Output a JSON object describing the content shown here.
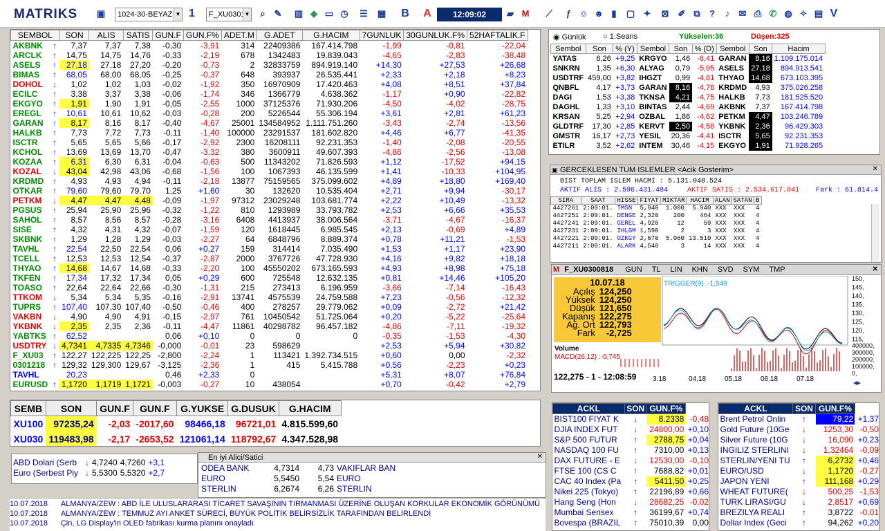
{
  "app": {
    "logo": "MATRIKS",
    "layout": "1024-30-BEYAZ",
    "page_num": "1",
    "symbol": "F_XU0301",
    "clock": "12:09:02",
    "b_label": "B",
    "a_label": "A"
  },
  "market_watch": {
    "headers": [
      "SEMBOL",
      "SON",
      "ALIS",
      "SATIS",
      "GUN.F",
      "GUN.F%",
      "ADET.M",
      "G.ADET",
      "G.HACIM",
      "7GUNLUK",
      "30GUNLUK.F%",
      "52HAFTALIK.F"
    ],
    "rows": [
      [
        "AKBNK",
        "u",
        "7,37",
        "7,37",
        "7,38",
        "-0,30",
        "-3,91",
        "314",
        "22409386",
        "167.414.798",
        "-1,99",
        "-0,81",
        "-22,04",
        ""
      ],
      [
        "ARCLK",
        "u",
        "14,75",
        "14,75",
        "14,76",
        "-0,33",
        "-2,19",
        "678",
        "1342483",
        "19.839.043",
        "-4,65",
        "-2,83",
        "-38,48",
        ""
      ],
      [
        "ASELS",
        "u",
        "27,18",
        "27,18",
        "27,20",
        "-0,20",
        "-0,73",
        "2",
        "32833759",
        "894.919.140",
        "+14,30",
        "+27,53",
        "+26,68",
        "son"
      ],
      [
        "BIMAS",
        "u",
        "68,05",
        "68,00",
        "68,05",
        "-0,25",
        "-0,37",
        "648",
        "393937",
        "26.535.441",
        "+2,33",
        "+2,18",
        "+8,23",
        ""
      ],
      [
        "DOHOL",
        "d",
        "1,02",
        "1,02",
        "1,03",
        "-0,02",
        "-1,92",
        "350",
        "16970909",
        "17.420.463",
        "+4,08",
        "+8,51",
        "+37,84",
        ""
      ],
      [
        "ECILC",
        "u",
        "3,38",
        "3,37",
        "3,38",
        "-0,06",
        "-1,74",
        "346",
        "1366779",
        "4.638.362",
        "-1,17",
        "+0,90",
        "-22,82",
        ""
      ],
      [
        "EKGYO",
        "u",
        "1,91",
        "1,90",
        "1,91",
        "-0,05",
        "-2,55",
        "1000",
        "37125376",
        "71.930.206",
        "-4,50",
        "-4,02",
        "-28,75",
        "son"
      ],
      [
        "EREGL",
        "u",
        "10,61",
        "10,61",
        "10,62",
        "-0,03",
        "-0,28",
        "200",
        "5226544",
        "55.306.194",
        "+3,61",
        "+2,81",
        "+61,23",
        ""
      ],
      [
        "GARAN",
        "u",
        "8,17",
        "8,16",
        "8,17",
        "-0,40",
        "-4,67",
        "25001",
        "134584952",
        "1.111.751.260",
        "-3,43",
        "-2,74",
        "-13,56",
        "son"
      ],
      [
        "HALKB",
        "u",
        "7,73",
        "7,72",
        "7,73",
        "-0,11",
        "-1,40",
        "100000",
        "23291537",
        "181.602.820",
        "+4,46",
        "+6,77",
        "-41,35",
        ""
      ],
      [
        "ISCTR",
        "u",
        "5,65",
        "5,65",
        "5,66",
        "-0,17",
        "-2,92",
        "2300",
        "16208111",
        "92.231.353",
        "-1,40",
        "-2,08",
        "-20,55",
        ""
      ],
      [
        "KCHOL",
        "u",
        "13,69",
        "13,69",
        "13,70",
        "-0,47",
        "-3,32",
        "380",
        "3600911",
        "49.607.393",
        "-4,86",
        "-2,56",
        "-13,08",
        ""
      ],
      [
        "KOZAA",
        "u",
        "6,31",
        "6,30",
        "6,31",
        "-0,04",
        "-0,63",
        "500",
        "11343202",
        "71.826.593",
        "+1,12",
        "-17,52",
        "+94,15",
        "son"
      ],
      [
        "KOZAL",
        "d",
        "43,04",
        "42,98",
        "43,06",
        "-0,68",
        "-1,56",
        "100",
        "1067393",
        "46.135.599",
        "+1,41",
        "-10,33",
        "+104,95",
        "son"
      ],
      [
        "KRDMD",
        "u",
        "4,93",
        "4,93",
        "4,94",
        "-0,11",
        "-2,18",
        "13877",
        "75159565",
        "375.099.602",
        "+4,89",
        "+18,80",
        "+169,40",
        ""
      ],
      [
        "OTKAR",
        "u",
        "79,60",
        "79,60",
        "79,70",
        "1,25",
        "+1,60",
        "30",
        "132620",
        "10.535.404",
        "+2,71",
        "+9,94",
        "-30,17",
        ""
      ],
      [
        "PETKM",
        "d",
        "4,47",
        "4,47",
        "4,48",
        "-0,09",
        "-1,97",
        "97312",
        "23029248",
        "103.681.774",
        "+2,22",
        "+10,49",
        "-13,32",
        "all"
      ],
      [
        "PGSUS",
        "u",
        "25,94",
        "25,90",
        "25,96",
        "-0,32",
        "-1,22",
        "810",
        "1293989",
        "33.793.782",
        "+2,53",
        "+6,66",
        "+35,53",
        ""
      ],
      [
        "SAHOL",
        "u",
        "8,57",
        "8,56",
        "8,57",
        "-0,28",
        "-3,16",
        "6408",
        "4413937",
        "38.006.564",
        "-3,71",
        "-4,67",
        "-16,37",
        ""
      ],
      [
        "SISE",
        "u",
        "4,32",
        "4,31",
        "4,32",
        "-0,07",
        "-1,59",
        "120",
        "1618445",
        "6.985.545",
        "+2,13",
        "-0,69",
        "+4,89",
        ""
      ],
      [
        "SKBNK",
        "u",
        "1,29",
        "1,28",
        "1,29",
        "-0,03",
        "-2,27",
        "64",
        "6848796",
        "8.889.374",
        "+0,78",
        "+11,21",
        "-1,53",
        ""
      ],
      [
        "TAVHL",
        "u",
        "22,54",
        "22,50",
        "22,54",
        "0,06",
        "+0,27",
        "159",
        "314414",
        "7.035.490",
        "+1,53",
        "+1,17",
        "+23,90",
        ""
      ],
      [
        "TCELL",
        "u",
        "12,53",
        "12,53",
        "12,54",
        "-0,37",
        "-2,87",
        "2000",
        "3767726",
        "47.728.930",
        "+4,16",
        "+9,82",
        "+18,18",
        ""
      ],
      [
        "THYAO",
        "u",
        "14,68",
        "14,67",
        "14,68",
        "-0,33",
        "-2,20",
        "100",
        "45550202",
        "673.165.593",
        "+4,93",
        "+8,98",
        "+75,18",
        "son"
      ],
      [
        "TKFEN",
        "u",
        "17,34",
        "17,32",
        "17,34",
        "0,05",
        "+0,29",
        "600",
        "725548",
        "12.632.135",
        "+0,81",
        "+14,46",
        "+105,20",
        ""
      ],
      [
        "TOASO",
        "u",
        "22,64",
        "22,64",
        "22,66",
        "-0,30",
        "-1,31",
        "215",
        "273413",
        "6.196.959",
        "-3,66",
        "-7,14",
        "-16,43",
        ""
      ],
      [
        "TTKOM",
        "d",
        "5,34",
        "5,34",
        "5,35",
        "-0,16",
        "-2,91",
        "13741",
        "4575539",
        "24.759.588",
        "+7,23",
        "-0,56",
        "-12,32",
        ""
      ],
      [
        "TUPRS",
        "u",
        "107,40",
        "107,30",
        "107,40",
        "-0,50",
        "-0,46",
        "400",
        "278257",
        "29.779.062",
        "+0,09",
        "-2,72",
        "+21,42",
        ""
      ],
      [
        "VAKBN",
        "d",
        "4,90",
        "4,90",
        "4,91",
        "-0,15",
        "-2,97",
        "761",
        "10450542",
        "51.725.064",
        "+0,20",
        "-5,22",
        "-25,64",
        ""
      ],
      [
        "YKBNK",
        "d",
        "2,35",
        "2,35",
        "2,36",
        "-0,11",
        "-4,47",
        "11861",
        "40298782",
        "96.457.182",
        "-4,86",
        "-7,11",
        "-19,32",
        "son"
      ],
      [
        "YABTKS",
        "u",
        "62,52",
        "",
        "",
        "0,06",
        "+0,10",
        "0",
        "0",
        "0",
        "-0,35",
        "-1,53",
        "-4,30",
        ""
      ],
      [
        "USDTRY",
        "d",
        "4,7341",
        "4,7335",
        "4,7346",
        "-0,000",
        "-0,01",
        "23",
        "598629",
        "",
        "+2,53",
        "+5,94",
        "+30,82",
        "all"
      ],
      [
        "F_XU03",
        "u",
        "122,27",
        "122,225",
        "122,25",
        "-2,800",
        "-2,24",
        "1",
        "113421",
        "1.392.734.515",
        "+0,60",
        "0,00",
        "-2,32",
        ""
      ],
      [
        "0301218",
        "u",
        "129,32",
        "129,300",
        "129,67",
        "-3,125",
        "-2,36",
        "1",
        "415",
        "5.415.788",
        "+0,56",
        "-2,23",
        "+0,23",
        ""
      ],
      [
        "TAVHL",
        "",
        "20,23",
        "",
        "",
        "0,46",
        "+2,33",
        "0",
        "",
        "",
        "+5,31",
        "+8,07",
        "+76,84",
        ""
      ],
      [
        "EURUSD",
        "u",
        "1,1720",
        "1,1719",
        "1,1721",
        "-0,003",
        "-0,27",
        "10",
        "438054",
        "",
        "+0,70",
        "-0,42",
        "+2,79",
        "all"
      ]
    ]
  },
  "indices": {
    "headers": [
      "SEMB",
      "SON",
      "GUN.F",
      "GUN.F",
      "G.YUKSE",
      "G.DUSUK",
      "G.HACIM"
    ],
    "rows": [
      [
        "XU100",
        "97235,24",
        "-2,03",
        "-2017,60",
        "98466,18",
        "96721,01",
        "4.815.599,60"
      ],
      [
        "XU030",
        "119483,98",
        "-2,17",
        "-2653,52",
        "121061,14",
        "118792,67",
        "4.347.528,98"
      ]
    ]
  },
  "fx": {
    "rows": [
      [
        "ABD Dolari (Serb",
        "4,7240",
        "4,7260",
        "+3,1"
      ],
      [
        "Euro (Serbest Piy",
        "5,5300",
        "5,5320",
        "+2,7"
      ]
    ]
  },
  "best_bid": {
    "title": "En iyi Alici/Satici",
    "rows": [
      [
        "ODEA BANK",
        "4,7314",
        "4,73",
        "VAKIFLAR BAN"
      ],
      [
        "EURO",
        "5,5450",
        "5,54",
        "EURO"
      ],
      [
        "STERLIN",
        "6,2674",
        "6,26",
        "STERLIN"
      ]
    ]
  },
  "news": [
    [
      "10.07.2018",
      "ALMANYA/ZEW : ABD İLE ULUSLARARASI TİCARET SAVAŞININ TIRMANMASI ÜZERİNE OLUŞAN KORKULAR EKONOMİK GÖRÜNÜMÜ"
    ],
    [
      "10.07.2018",
      "ALMANYA/ZEW : TEMMUZ AYI ANKET SÜRECİ, BÜYÜK POLİTİK BELİRSİZLİK TARAFINDAN BELİRLENDİ"
    ],
    [
      "10.07.2018",
      "Çin, LG Display'in OLED fabrikası kurma planını onayladı"
    ]
  ],
  "ranking": {
    "radio1": "Günlük",
    "radio2": "1.Seans",
    "up_label": "Yükselen:36",
    "down_label": "Düşen:325",
    "headers": [
      "Sembol",
      "Son",
      "% (Y)",
      "Sembol",
      "Son",
      "% (D)",
      "Sembol",
      "Son",
      "Hacim"
    ],
    "rows": [
      [
        "YATAS",
        "6,26",
        "+9,25",
        "KRGYO",
        "1,46",
        "-6,41",
        "GARAN",
        "8,16",
        "1.109.175.014"
      ],
      [
        "SNKRN",
        "1,35",
        "+6,30",
        "ALYAG",
        "0,79",
        "-5,95",
        "ASELS",
        "27,18",
        "894.913.541"
      ],
      [
        "USDTRF",
        "459,00",
        "+3,82",
        "IHGZT",
        "0,99",
        "-4,81",
        "THYAO",
        "14,68",
        "673.103.395"
      ],
      [
        "QNBFL",
        "4,17",
        "+3,73",
        "GARAN",
        "8,16",
        "-4,78",
        "KRDMD",
        "4,93",
        "375.026.258"
      ],
      [
        "DAGI",
        "1,53",
        "+3,38",
        "TKNSA",
        "4,21",
        "-4,75",
        "HALKB",
        "7,73",
        "181.525.520"
      ],
      [
        "DAGHL",
        "1,33",
        "+3,10",
        "BINTAS",
        "2,44",
        "-4,69",
        "AKBNK",
        "7,37",
        "167.414.798"
      ],
      [
        "KRSAN",
        "5,25",
        "+2,94",
        "OZBAL",
        "1,86",
        "-4,62",
        "PETKM",
        "4,47",
        "103.246.789"
      ],
      [
        "GLDTRF",
        "17,30",
        "+2,85",
        "KERVT",
        "2,50",
        "-4,58",
        "YKBNK",
        "2,36",
        "96.429.303"
      ],
      [
        "GMSTR",
        "16,17",
        "+2,73",
        "YESIL",
        "20,36",
        "-4,41",
        "ISCTR",
        "5,65",
        "92.231.353"
      ],
      [
        "ETILR",
        "3,52",
        "+2,62",
        "INTEM",
        "30,46",
        "-4,15",
        "EKGYO",
        "1,91",
        "71.928.265"
      ]
    ]
  },
  "trades": {
    "title": "GERCEKLESEN TUM ISLEMLER <Acik Gosterim>",
    "total": "BIST TOPLAM ISLEM HACMI : 5.131.048.524",
    "buy": "AKTIF ALIS : 2.596.431.484",
    "sell": "AKTIF SATIS : 2.534.617.041",
    "diff": "Fark : 61.814.4",
    "headers": [
      "SIRA",
      "SAAT",
      "HISSE",
      "FIYAT",
      "MIKTAR",
      "HACIM",
      "ALAN",
      "SATAN",
      "B"
    ],
    "rows": [
      [
        "4427261",
        "2:09:01.",
        "TMSN",
        "5,940",
        "1.000",
        "5.940",
        "XXX",
        "XXX",
        "4"
      ],
      [
        "4427251",
        "2:09:01.",
        "DENGE",
        "2,320",
        "200",
        "464",
        "XXX",
        "XXX",
        "4"
      ],
      [
        "4427241",
        "2:09:01.",
        "GEREL",
        "4,920",
        "12",
        "59",
        "XXX",
        "XXX",
        "4"
      ],
      [
        "4427231",
        "2:09:01.",
        "IHLGM",
        "1,590",
        "2",
        "3",
        "XXX",
        "XXX",
        "4"
      ],
      [
        "4427221",
        "2:09:01.",
        "OZKGY",
        "2,670",
        "5.060",
        "13.510",
        "XXX",
        "XXX",
        "4"
      ],
      [
        "4427211",
        "2:09:01.",
        "ALARK",
        "4,540",
        "3",
        "14",
        "XXX",
        "XXX",
        "4"
      ]
    ]
  },
  "chart": {
    "symbol": "F_XU0300818",
    "tabs": [
      "GUN",
      "TL",
      "LIN",
      "KHN",
      "SVD",
      "SYM",
      "TMP"
    ],
    "date": "10.07.18",
    "info": [
      [
        "Açılış",
        "124,250"
      ],
      [
        "Yüksek",
        "124,250"
      ],
      [
        "Düşük",
        "121,650"
      ],
      [
        "Kapanış",
        "122,275"
      ],
      [
        "Ağ. Ort",
        "122,793"
      ],
      [
        "Fark",
        "-2,725"
      ]
    ],
    "trigger": "TRIGGER(9)",
    "trigger_val": "-1,549",
    "volume": "Volume",
    "macd": "MACD(26,12)",
    "macd_val": "-0,745",
    "status": "122,275 - 1 - 12:08:59",
    "yticks": [
      "150,",
      "145,",
      "140,",
      "135,",
      "130,",
      "125,",
      "120,",
      "115,"
    ],
    "vticks": [
      "400000,",
      "300000,",
      "200000,",
      "100000,",
      "0,"
    ],
    "dates": [
      "3.18",
      "04.18",
      "05.18",
      "06.18",
      "07.18"
    ]
  },
  "global_left": {
    "headers": [
      "ACKL",
      "SON",
      "GUN.F%"
    ],
    "rows": [
      [
        "BIST100 FIYAT K",
        "d",
        "8.2338",
        "-0,48",
        "y"
      ],
      [
        "DJIA INDEX FUT",
        "d",
        "24800,00",
        "+0,10",
        ""
      ],
      [
        "S&P 500 FUTUR",
        "u",
        "2788,75",
        "+0,04",
        "y"
      ],
      [
        "NASDAQ 100 FU",
        "u",
        "7310,00",
        "+0,13",
        ""
      ],
      [
        "DAX FUTURE - E",
        "d",
        "12530,00",
        "-0,10",
        ""
      ],
      [
        "FTSE 100 (CS C",
        "u",
        "7688,82",
        "+0,01",
        ""
      ],
      [
        "CAC 40 Index (Pa",
        "u",
        "5411,50",
        "+0,25",
        "y"
      ],
      [
        "Nikei 225 (Tokyo)",
        "u",
        "22196,89",
        "+0,66",
        ""
      ],
      [
        "Hang Seng (Hon",
        "d",
        "28682,25",
        "-0,02",
        ""
      ],
      [
        "Mumbai Sensex",
        "u",
        "36199,67",
        "+0,74",
        ""
      ],
      [
        "Bovespa (BRAZIL",
        "u",
        "75010,39",
        "0,00",
        ""
      ]
    ]
  },
  "global_right": {
    "headers": [
      "ACKL",
      "SON",
      "GUN.F%"
    ],
    "rows": [
      [
        "Brent Petrol Onlin",
        "u",
        "79,22",
        "+1,37",
        "b"
      ],
      [
        "Gold Future (10Ge",
        "d",
        "1253,30",
        "-0,50",
        ""
      ],
      [
        "Silver Future (10G",
        "d",
        "16,090",
        "+0,23",
        ""
      ],
      [
        "INGILIZ STERLINI",
        "d",
        "1,32464",
        "-0,09",
        ""
      ],
      [
        "STERLIN/YENI TU",
        "u",
        "6,2732",
        "+0,46",
        "y"
      ],
      [
        "EURO/USD",
        "d",
        "1,1720",
        "-0,27",
        "y"
      ],
      [
        "JAPON YENI",
        "u",
        "111,168",
        "+0,29",
        "y"
      ],
      [
        "WHEAT FUTURE(",
        "d",
        "500,25",
        "-1,53",
        ""
      ],
      [
        "TURK LIRASI/GU",
        "d",
        "2,8517",
        "+0,69",
        ""
      ],
      [
        "BREZILYA REALI",
        "u",
        "3,8722",
        "-0,01",
        ""
      ],
      [
        "Dollar Index (Geci",
        "u",
        "94,262",
        "+0,20",
        ""
      ]
    ]
  }
}
